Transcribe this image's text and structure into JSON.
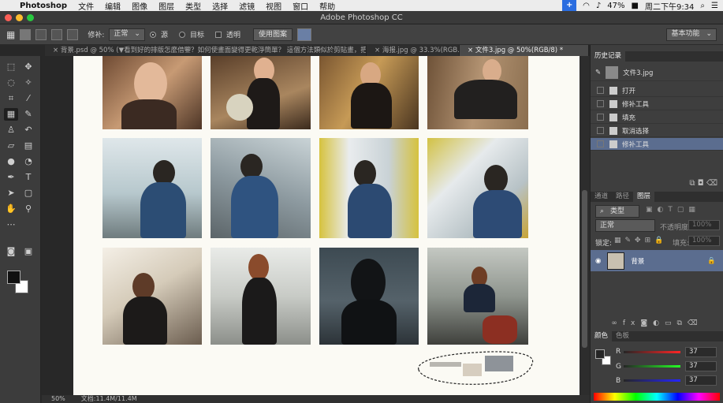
{
  "menubar": {
    "app": "Photoshop",
    "items": [
      "文件",
      "编辑",
      "图像",
      "图层",
      "类型",
      "选择",
      "滤镜",
      "视图",
      "窗口",
      "帮助"
    ],
    "battery": "47%",
    "clock": "周二下午9:34"
  },
  "window": {
    "title": "Adobe Photoshop CC"
  },
  "options": {
    "patch_label": "修补:",
    "mode_value": "正常",
    "source_label": "源",
    "target_label": "目标",
    "transparent_label": "透明",
    "use_pattern_label": "使用图案",
    "workspace": "基本功能"
  },
  "tabs": [
    {
      "label": "背景.psd @ 50% (▼看到好的排版怎麼借鑒？如何使畫面變得更乾淨簡單？ 這個方法類似於剪貼畫，把..."
    },
    {
      "label": "海报.jpg @ 33.3%(RGB..."
    },
    {
      "label": "文件3.jpg @ 50%(RGB/8) *"
    }
  ],
  "history": {
    "tab": "历史记录",
    "snapshot": "文件3.jpg",
    "steps": [
      "打开",
      "修补工具",
      "填充",
      "取消选择",
      "修补工具"
    ]
  },
  "layers": {
    "tabs": [
      "通道",
      "路径",
      "图层"
    ],
    "kind": "类型",
    "blend": "正常",
    "opacity_label": "不透明度:",
    "opacity": "100%",
    "lock_label": "锁定:",
    "fill_label": "填充:",
    "fill": "100%",
    "layer_name": "背景"
  },
  "color": {
    "tabs": [
      "颜色",
      "色板"
    ],
    "r_label": "R",
    "g_label": "G",
    "b_label": "B",
    "r": "37",
    "g": "37",
    "b": "37"
  },
  "status": {
    "zoom": "50%",
    "doc": "文档:11.4M/11.4M"
  },
  "colors": {
    "accent": "#5b6d8f",
    "close": "#fc5f57",
    "min": "#fdbc2e",
    "max": "#28c840"
  }
}
